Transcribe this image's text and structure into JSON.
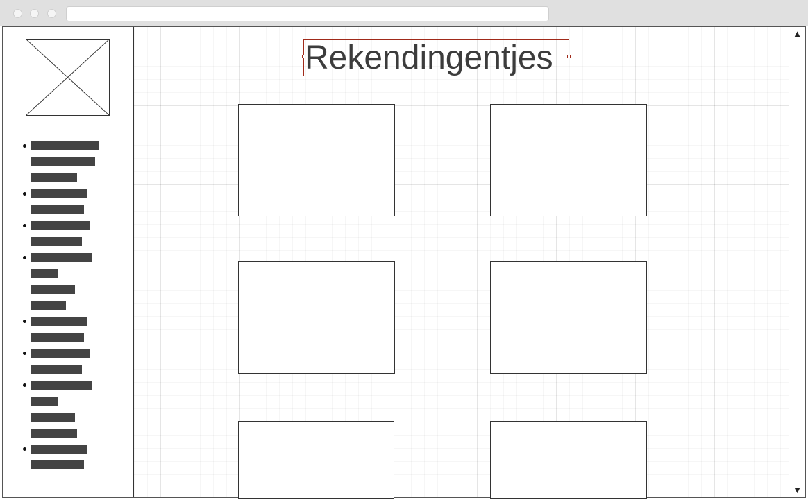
{
  "window": {
    "title_bar_buttons": [
      "close-dot",
      "minimize-dot",
      "maximize-dot"
    ],
    "url": ""
  },
  "sidebar": {
    "logo_icon": "image-placeholder-icon",
    "nav_items": [
      {
        "lines": [
          99,
          93,
          67
        ]
      },
      {
        "lines": [
          81,
          77
        ]
      },
      {
        "lines": [
          86,
          74
        ]
      },
      {
        "lines": [
          88,
          40,
          64,
          51
        ]
      },
      {
        "lines": [
          81,
          77
        ]
      },
      {
        "lines": [
          86,
          74
        ]
      },
      {
        "lines": [
          88,
          40,
          64,
          67
        ]
      },
      {
        "lines": [
          81,
          77
        ]
      }
    ]
  },
  "main": {
    "title": "Rekendingentjes",
    "cards": [
      "card-1",
      "card-2",
      "card-3",
      "card-4",
      "card-5",
      "card-6"
    ]
  },
  "scrollbar": {
    "up_icon": "▲",
    "down_icon": "▼"
  },
  "colors": {
    "selection": "#a02a1a",
    "text": "#3c3c3c",
    "placeholder_bar": "#444444"
  }
}
